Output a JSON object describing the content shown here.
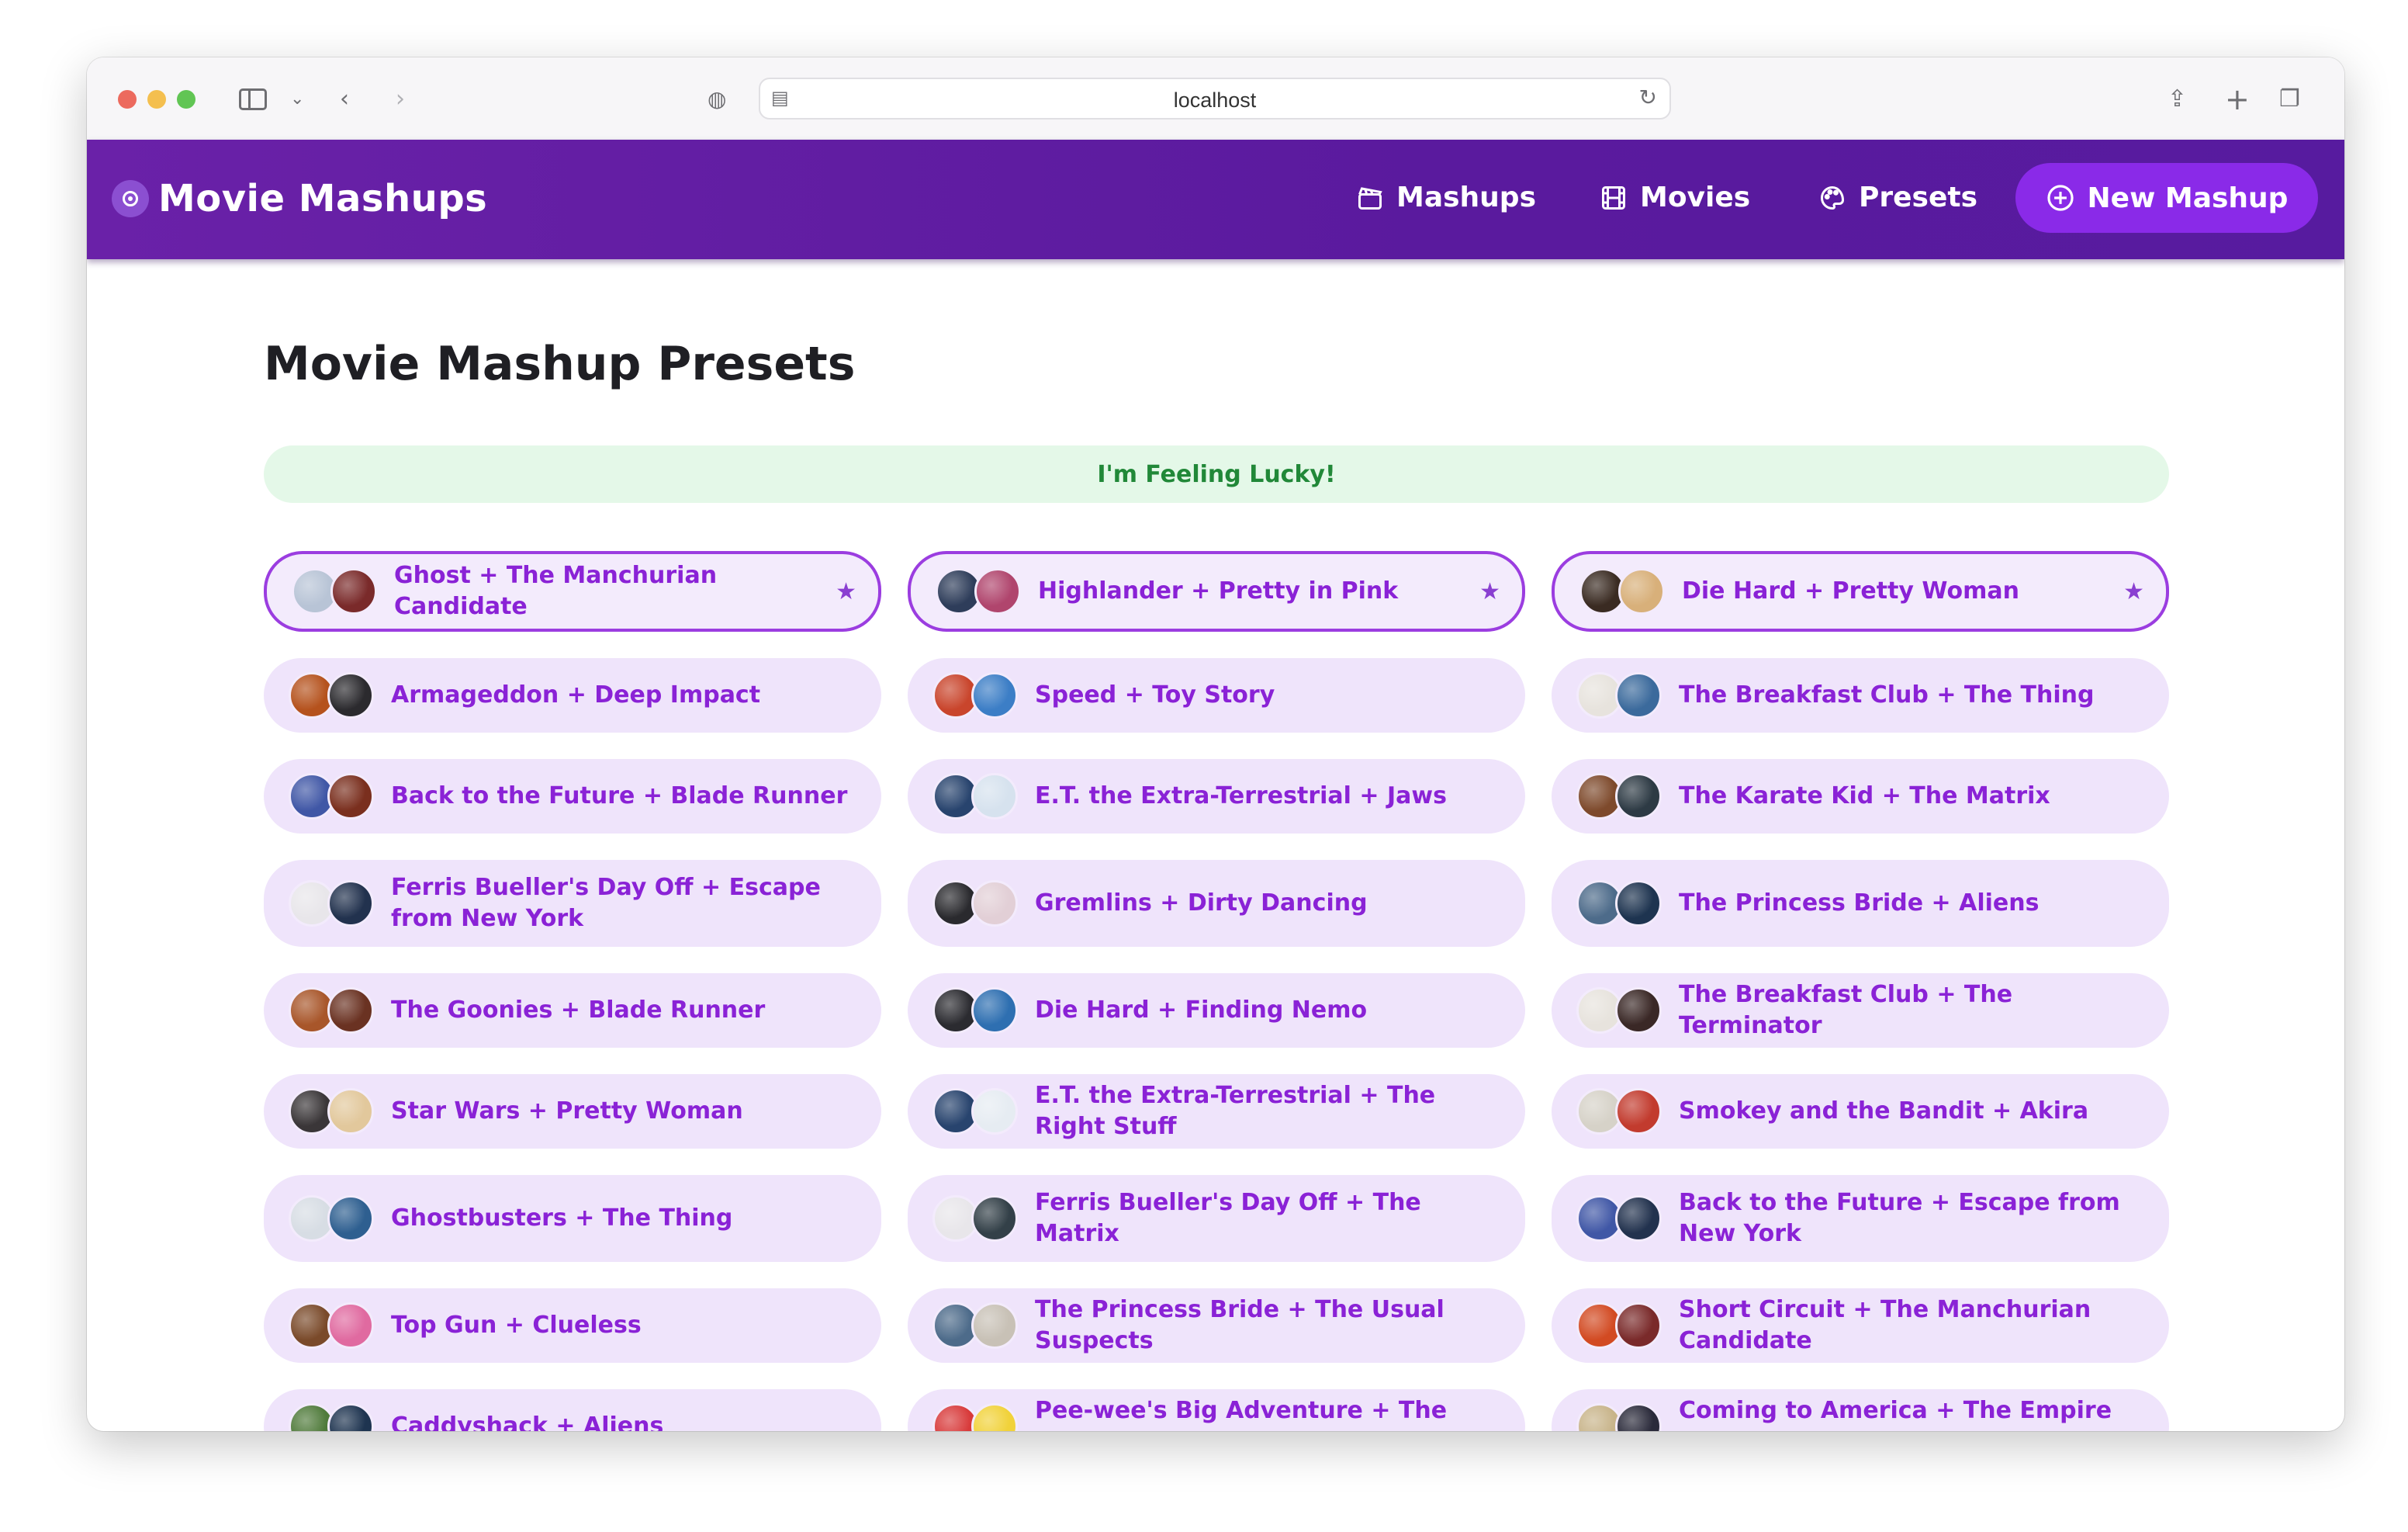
{
  "browser": {
    "url": "localhost"
  },
  "app": {
    "brand": "Movie Mashups",
    "nav": {
      "mashups": "Mashups",
      "movies": "Movies",
      "presets": "Presets",
      "new_mashup": "New Mashup"
    }
  },
  "page": {
    "title": "Movie Mashup Presets",
    "lucky_button": "I'm Feeling Lucky!"
  },
  "presets": [
    {
      "label": "Ghost + The Manchurian Candidate",
      "favorite": true,
      "thumb_colors": [
        "#b8c4d6",
        "#7a2a2a"
      ]
    },
    {
      "label": "Highlander + Pretty in Pink",
      "favorite": true,
      "thumb_colors": [
        "#2e3d5a",
        "#b0456d"
      ]
    },
    {
      "label": "Die Hard + Pretty Woman",
      "favorite": true,
      "thumb_colors": [
        "#3a2b22",
        "#d8b07a"
      ]
    },
    {
      "label": "Armageddon + Deep Impact",
      "favorite": false,
      "thumb_colors": [
        "#b5521d",
        "#2b2a2e"
      ]
    },
    {
      "label": "Speed + Toy Story",
      "favorite": false,
      "thumb_colors": [
        "#c9452c",
        "#3c7ec6"
      ]
    },
    {
      "label": "The Breakfast Club + The Thing",
      "favorite": false,
      "thumb_colors": [
        "#e7e3dd",
        "#3b6a9c"
      ]
    },
    {
      "label": "Back to the Future + Blade Runner",
      "favorite": false,
      "thumb_colors": [
        "#4057a6",
        "#7a2f1e"
      ]
    },
    {
      "label": "E.T. the Extra-Terrestrial + Jaws",
      "favorite": false,
      "thumb_colors": [
        "#28446e",
        "#d6e2ee"
      ]
    },
    {
      "label": "The Karate Kid + The Matrix",
      "favorite": false,
      "thumb_colors": [
        "#7e4a2c",
        "#2d3a44"
      ]
    },
    {
      "label": "Ferris Bueller's Day Off + Escape from New York",
      "favorite": false,
      "thumb_colors": [
        "#e8e6ea",
        "#22324e"
      ]
    },
    {
      "label": "Gremlins + Dirty Dancing",
      "favorite": false,
      "thumb_colors": [
        "#2a2a2e",
        "#e2cfd6"
      ]
    },
    {
      "label": "The Princess Bride + Aliens",
      "favorite": false,
      "thumb_colors": [
        "#4d6b8a",
        "#1e3450"
      ]
    },
    {
      "label": "The Goonies + Blade Runner",
      "favorite": false,
      "thumb_colors": [
        "#a8562a",
        "#6a3222"
      ]
    },
    {
      "label": "Die Hard + Finding Nemo",
      "favorite": false,
      "thumb_colors": [
        "#2b2b30",
        "#2e6fb1"
      ]
    },
    {
      "label": "The Breakfast Club + The Terminator",
      "favorite": false,
      "thumb_colors": [
        "#e7e3dd",
        "#3a2826"
      ]
    },
    {
      "label": "Star Wars + Pretty Woman",
      "favorite": false,
      "thumb_colors": [
        "#3a3638",
        "#e2c89c"
      ]
    },
    {
      "label": "E.T. the Extra-Terrestrial + The Right Stuff",
      "favorite": false,
      "thumb_colors": [
        "#28446e",
        "#e6ecf2"
      ]
    },
    {
      "label": "Smokey and the Bandit + Akira",
      "favorite": false,
      "thumb_colors": [
        "#d6d2c8",
        "#c23b2e"
      ]
    },
    {
      "label": "Ghostbusters + The Thing",
      "favorite": false,
      "thumb_colors": [
        "#d7dde4",
        "#2e5f90"
      ]
    },
    {
      "label": "Ferris Bueller's Day Off + The Matrix",
      "favorite": false,
      "thumb_colors": [
        "#e8e6ea",
        "#334048"
      ]
    },
    {
      "label": "Back to the Future + Escape from New York",
      "favorite": false,
      "thumb_colors": [
        "#4057a6",
        "#22324e"
      ]
    },
    {
      "label": "Top Gun + Clueless",
      "favorite": false,
      "thumb_colors": [
        "#7a4a2a",
        "#e06aa0"
      ]
    },
    {
      "label": "The Princess Bride + The Usual Suspects",
      "favorite": false,
      "thumb_colors": [
        "#4d6b8a",
        "#c8c1b6"
      ]
    },
    {
      "label": "Short Circuit + The Manchurian Candidate",
      "favorite": false,
      "thumb_colors": [
        "#d24a22",
        "#7a2a2a"
      ]
    },
    {
      "label": "Caddyshack + Aliens",
      "favorite": false,
      "thumb_colors": [
        "#4f7a3a",
        "#1e3450"
      ]
    },
    {
      "label": "Pee-wee's Big Adventure + The Shining",
      "favorite": false,
      "thumb_colors": [
        "#d83a3a",
        "#f1d23a"
      ]
    },
    {
      "label": "Coming to America + The Empire Strikes",
      "favorite": false,
      "thumb_colors": [
        "#c8b48a",
        "#2a2a3a"
      ]
    }
  ],
  "colors": {
    "brand_purple": "#5a1a9e",
    "accent_purple": "#8a2ae8",
    "card_bg": "#efe4fb",
    "card_text": "#8a22d6",
    "lucky_bg": "#e4f8e8",
    "lucky_text": "#218838"
  }
}
